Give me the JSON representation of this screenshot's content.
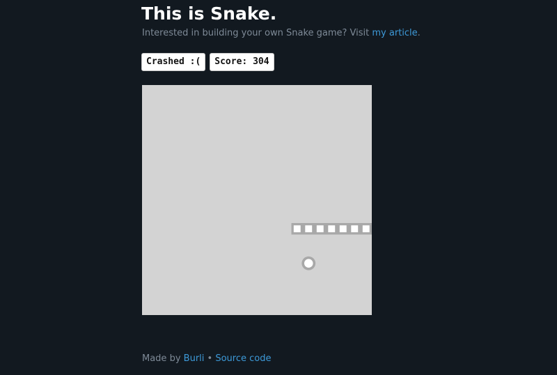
{
  "header": {
    "title": "This is Snake.",
    "subtitle_prefix": "Interested in building your own Snake game? Visit ",
    "subtitle_link": "my article",
    "subtitle_suffix": "."
  },
  "status": {
    "state_label": "Crashed :(",
    "score_label": "Score: 304"
  },
  "game": {
    "grid_size": 20,
    "snake": [
      [
        19,
        12
      ],
      [
        18,
        12
      ],
      [
        17,
        12
      ],
      [
        16,
        12
      ],
      [
        15,
        12
      ],
      [
        14,
        12
      ],
      [
        13,
        12
      ]
    ],
    "apple": [
      14,
      15
    ],
    "colors": {
      "board": "#d3d3d3",
      "snake_border": "#a8a8a8",
      "snake_fill": "#ffffff",
      "apple_border": "#a8a8a8",
      "apple_fill": "#ffffff"
    }
  },
  "footer": {
    "made_by": "Made by ",
    "author": "Burli",
    "separator": " • ",
    "source": "Source code"
  }
}
